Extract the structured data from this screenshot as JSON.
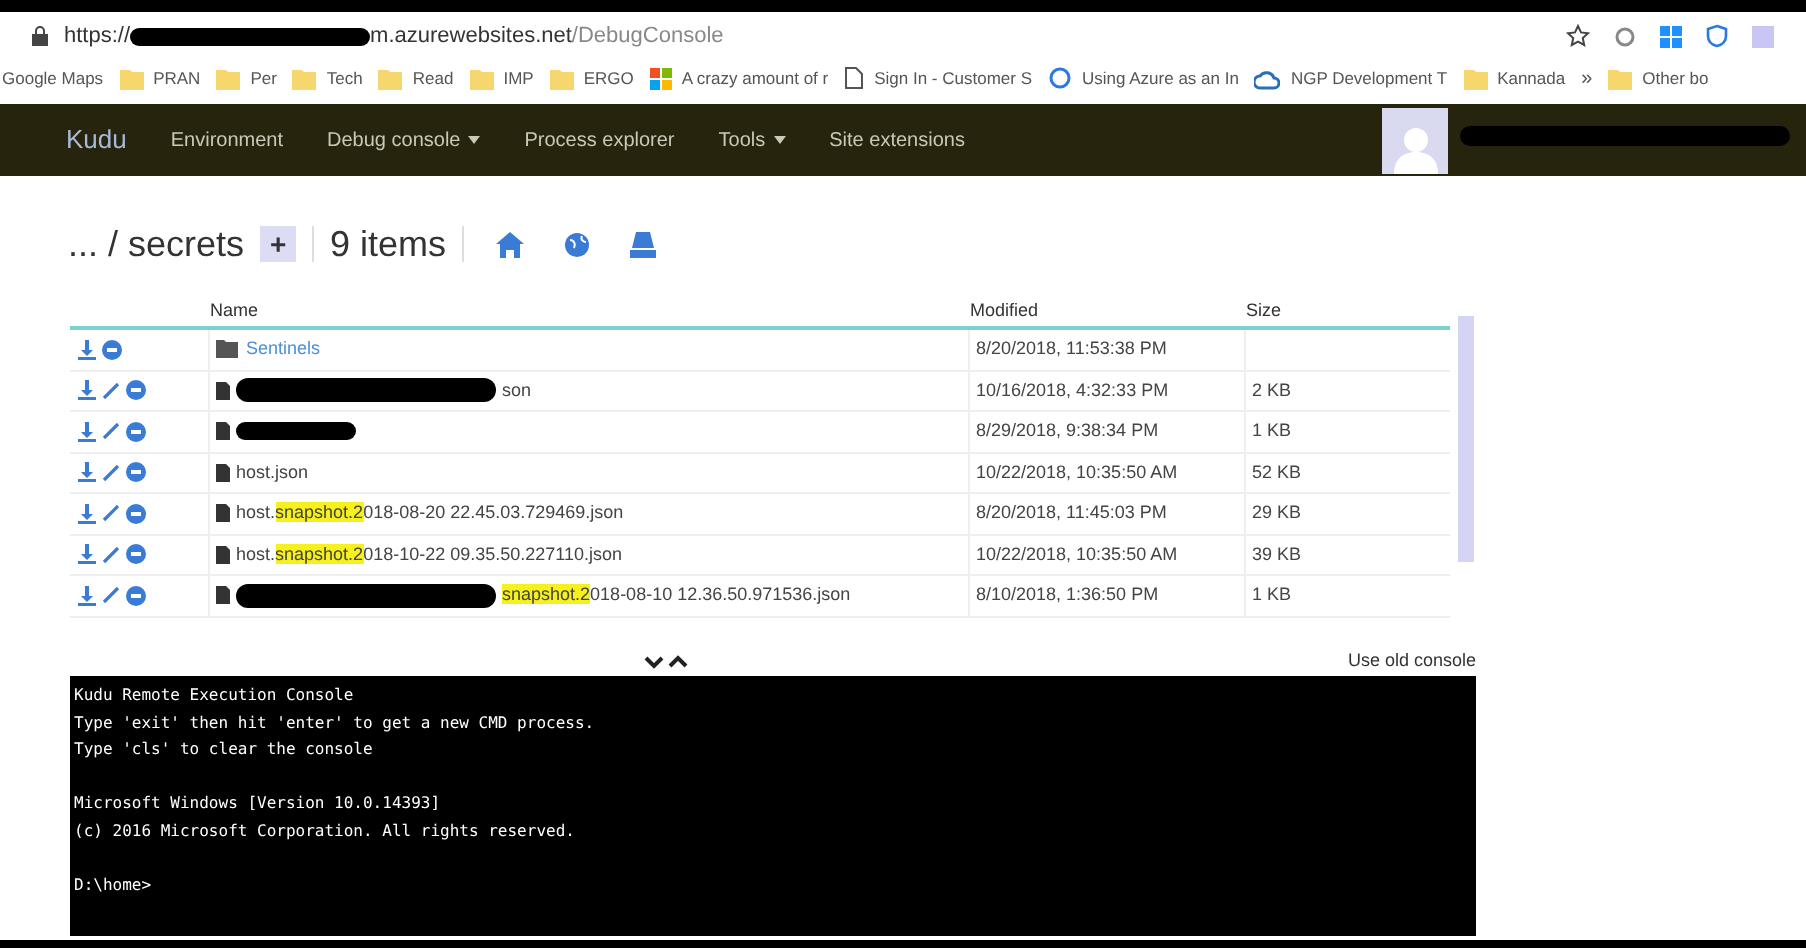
{
  "browser": {
    "url_prefix": "https://",
    "url_host": "m.azurewebsites.net",
    "url_path": "/DebugConsole"
  },
  "bookmarks": [
    {
      "kind": "none",
      "label": "Google Maps"
    },
    {
      "kind": "folder",
      "label": "PRAN"
    },
    {
      "kind": "folder",
      "label": "Per"
    },
    {
      "kind": "folder",
      "label": "Tech"
    },
    {
      "kind": "folder",
      "label": "Read"
    },
    {
      "kind": "folder",
      "label": "IMP"
    },
    {
      "kind": "folder",
      "label": "ERGO"
    },
    {
      "kind": "windows",
      "label": "A crazy amount of r"
    },
    {
      "kind": "page",
      "label": "Sign In - Customer S"
    },
    {
      "kind": "circle",
      "label": "Using Azure as an In"
    },
    {
      "kind": "cloud",
      "label": "NGP Development T"
    },
    {
      "kind": "folder",
      "label": "Kannada"
    },
    {
      "kind": "more",
      "label": "»"
    },
    {
      "kind": "folder",
      "label": "Other bo"
    }
  ],
  "nav": {
    "brand": "Kudu",
    "items": [
      {
        "label": "Environment",
        "dropdown": false
      },
      {
        "label": "Debug console",
        "dropdown": true
      },
      {
        "label": "Process explorer",
        "dropdown": false
      },
      {
        "label": "Tools",
        "dropdown": true
      },
      {
        "label": "Site extensions",
        "dropdown": false
      }
    ]
  },
  "breadcrumb": {
    "path": "... / secrets",
    "add": "+",
    "count": "9 items"
  },
  "table": {
    "columns": [
      "Name",
      "Modified",
      "Size"
    ],
    "rows": [
      {
        "kind": "folder",
        "name": [
          {
            "text": "Sentinels",
            "highlighted": false
          }
        ],
        "modified": "8/20/2018, 11:53:38 PM",
        "size": "",
        "redacted": false
      },
      {
        "kind": "file",
        "name": [
          {
            "text": "son",
            "highlighted": false
          }
        ],
        "modified": "10/16/2018, 4:32:33 PM",
        "size": "2 KB",
        "redacted": true
      },
      {
        "kind": "file",
        "name": [],
        "modified": "8/29/2018, 9:38:34 PM",
        "size": "1 KB",
        "redacted": true
      },
      {
        "kind": "file",
        "name": [
          {
            "text": "host.json",
            "highlighted": false
          }
        ],
        "modified": "10/22/2018, 10:35:50 AM",
        "size": "52 KB",
        "redacted": false
      },
      {
        "kind": "file",
        "name": [
          {
            "text": "host.",
            "highlighted": false
          },
          {
            "text": "snapshot.2",
            "highlighted": true
          },
          {
            "text": "018-08-20 22.45.03.729469.json",
            "highlighted": false
          }
        ],
        "modified": "8/20/2018, 11:45:03 PM",
        "size": "29 KB",
        "redacted": false
      },
      {
        "kind": "file",
        "name": [
          {
            "text": "host.",
            "highlighted": false
          },
          {
            "text": "snapshot.2",
            "highlighted": true
          },
          {
            "text": "018-10-22 09.35.50.227110.json",
            "highlighted": false
          }
        ],
        "modified": "10/22/2018, 10:35:50 AM",
        "size": "39 KB",
        "redacted": false
      },
      {
        "kind": "file",
        "name": [
          {
            "text": "snapshot.2",
            "highlighted": true
          },
          {
            "text": "018-08-10 12.36.50.971536.json",
            "highlighted": false
          }
        ],
        "modified": "8/10/2018, 1:36:50 PM",
        "size": "1 KB",
        "redacted": true
      }
    ]
  },
  "old_console_link": "Use old console",
  "console": {
    "lines": [
      {
        "text": "Kudu Remote Execution Console",
        "gap_before": false
      },
      {
        "text": "Type 'exit' then hit 'enter' to get a new CMD process.",
        "gap_before": false
      },
      {
        "text": "Type 'cls' to clear the console",
        "gap_before": false
      },
      {
        "text": "Microsoft Windows [Version 10.0.14393]",
        "gap_before": true
      },
      {
        "text": "(c) 2016 Microsoft Corporation. All rights reserved.",
        "gap_before": false
      },
      {
        "text": "D:\\home>",
        "gap_before": true
      }
    ]
  }
}
